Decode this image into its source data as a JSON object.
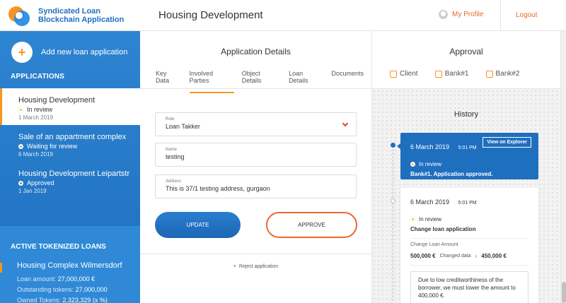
{
  "app": {
    "name_line1": "Syndicated Loan",
    "name_line2": "Blockchain Application"
  },
  "header": {
    "title": "Housing Development",
    "profile_label": "My Profile",
    "logout_label": "Logout"
  },
  "sidebar": {
    "add_label": "Add new loan application",
    "add_icon": "+",
    "applications_title": "APPLICATIONS",
    "applications": [
      {
        "name": "Housing Development",
        "status": "In review",
        "status_color": "#f7c52b",
        "date": "1 March 2019"
      },
      {
        "name": "Sale of an appartment complex",
        "status": "Waiting for review",
        "status_color": "#9e9e9e",
        "date": "6 March 2019"
      },
      {
        "name": "Housing Development Leipartstr",
        "status": "Approved",
        "status_color": "#4caf50",
        "date": "1 Jan 2019"
      }
    ],
    "tokenized_title": "ACTIVE TOKENIZED LOANS",
    "tokenized": {
      "name": "Housing Complex Wilmersdorf",
      "loan_amount_label": "Loan amount:",
      "loan_amount": "27,000,000 €",
      "outstanding_label": "Outstanding tokens:",
      "outstanding": "27,000,000",
      "owned_label": "Owned Tokens:",
      "owned": "2,323,329 (x %)"
    }
  },
  "details": {
    "title": "Application Details",
    "tabs": [
      "Key Data",
      "Involved Parties",
      "Object Details",
      "Loan Details",
      "Documents"
    ],
    "active_tab": "Involved Parties",
    "role": {
      "label": "Role",
      "value": "Loan Takker"
    },
    "name": {
      "label": "Name",
      "value": "testing"
    },
    "address": {
      "label": "Address",
      "value": "This is 37/1 testing address, gurgaon"
    },
    "update_label": "UPDATE",
    "approve_label": "APPROVE",
    "reject_label": "Reject application"
  },
  "approval": {
    "title": "Approval",
    "options": [
      "Client",
      "Bank#1",
      "Bank#2"
    ]
  },
  "history": {
    "title": "History",
    "entries": [
      {
        "date": "6 March 2019",
        "time": "5:01 PM",
        "button": "View on Explorer",
        "status": "In review",
        "message": "Bank#1. Application approved."
      },
      {
        "date": "6 March 2019",
        "time": "5:01 PM",
        "status": "In review",
        "message": "Change loan application",
        "change_title": "Change Loan Amount",
        "from": "500,000 €",
        "changed_label": "Changed data",
        "to": "450,000 €",
        "note": "Due to low creditworthiness of the borrower, we must lower the amount to 400,000 €."
      }
    ]
  },
  "colors": {
    "primary": "#1f6fbf",
    "accent": "#f7941d",
    "link": "#e96a2b"
  }
}
